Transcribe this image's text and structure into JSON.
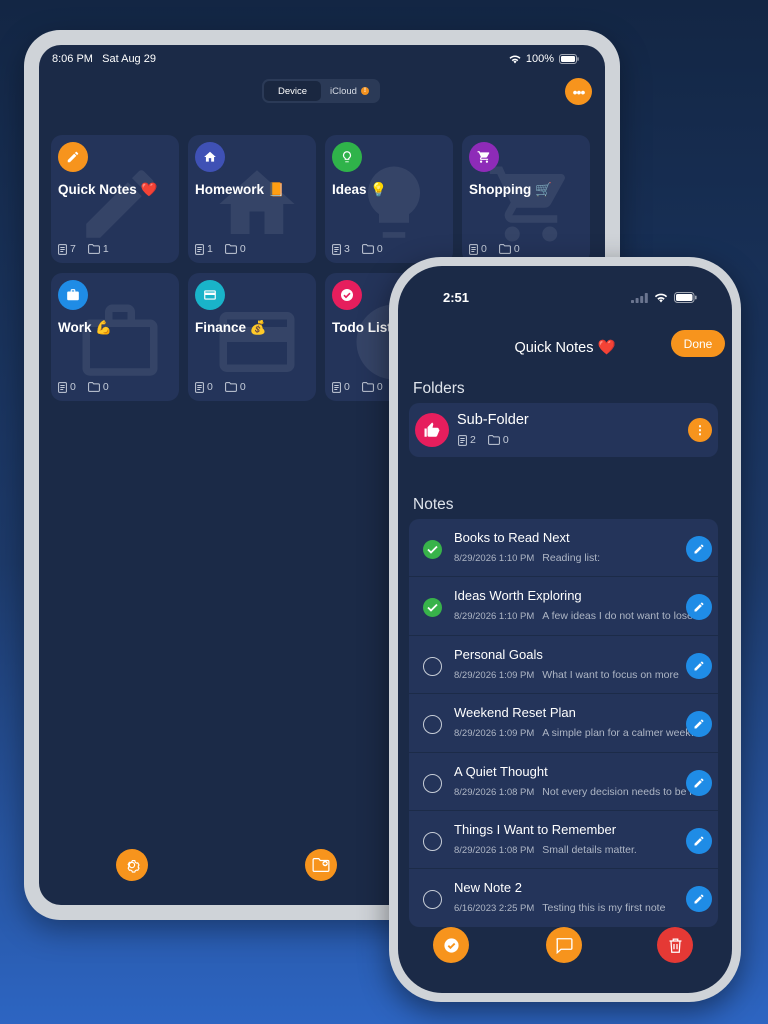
{
  "ipad": {
    "status": {
      "time": "8:06 PM",
      "date": "Sat Aug 29",
      "battery": "100%"
    },
    "segment": {
      "device_label": "Device",
      "icloud_label": "iCloud",
      "icloud_badge": "!"
    },
    "more_icon": "ellipsis-icon",
    "folders": [
      {
        "name": "Quick Notes ❤️",
        "notes": "7",
        "folders": "1",
        "icon": "pencil-icon",
        "color": "#f7941d"
      },
      {
        "name": "Homework 📙",
        "notes": "1",
        "folders": "0",
        "icon": "house-icon",
        "color": "#3f51b5"
      },
      {
        "name": "Ideas 💡",
        "notes": "3",
        "folders": "0",
        "icon": "lightbulb-icon",
        "color": "#2fb34a"
      },
      {
        "name": "Shopping 🛒",
        "notes": "0",
        "folders": "0",
        "icon": "cart-icon",
        "color": "#8e2bb8"
      },
      {
        "name": "Work 💪",
        "notes": "0",
        "folders": "0",
        "icon": "briefcase-icon",
        "color": "#1f8ce6"
      },
      {
        "name": "Finance 💰",
        "notes": "0",
        "folders": "0",
        "icon": "card-icon",
        "color": "#19b3c9"
      },
      {
        "name": "Todo List",
        "notes": "0",
        "folders": "0",
        "icon": "check-icon",
        "color": "#e61e5d"
      }
    ],
    "bottom": {
      "settings_icon": "gear-icon",
      "new_folder_icon": "folder-add-icon"
    }
  },
  "iphone": {
    "status": {
      "time": "2:51"
    },
    "title": "Quick Notes ❤️",
    "done_label": "Done",
    "folders_heading": "Folders",
    "subfolder": {
      "name": "Sub-Folder",
      "notes": "2",
      "folders": "0"
    },
    "notes_heading": "Notes",
    "notes": [
      {
        "title": "Books to Read Next",
        "date": "8/29/2026 1:10 PM",
        "preview": "Reading list:",
        "done": true
      },
      {
        "title": "Ideas Worth Exploring",
        "date": "8/29/2026 1:10 PM",
        "preview": "A few ideas I do not want to lose",
        "done": true
      },
      {
        "title": "Personal Goals",
        "date": "8/29/2026 1:09 PM",
        "preview": "What I want to focus on more",
        "done": false
      },
      {
        "title": "Weekend Reset Plan",
        "date": "8/29/2026 1:09 PM",
        "preview": "A simple plan for a calmer weekend",
        "done": false
      },
      {
        "title": "A Quiet Thought",
        "date": "8/29/2026 1:08 PM",
        "preview": "Not every decision needs to be rushed",
        "done": false
      },
      {
        "title": "Things I Want to Remember",
        "date": "8/29/2026 1:08 PM",
        "preview": "Small details matter.",
        "done": false
      },
      {
        "title": "New Note 2",
        "date": "6/16/2023 2:25 PM",
        "preview": "Testing this is my first note",
        "done": false
      }
    ],
    "bottom": {
      "check_color": "#f7941d",
      "comment_color": "#f7941d",
      "delete_color": "#e53935"
    }
  }
}
